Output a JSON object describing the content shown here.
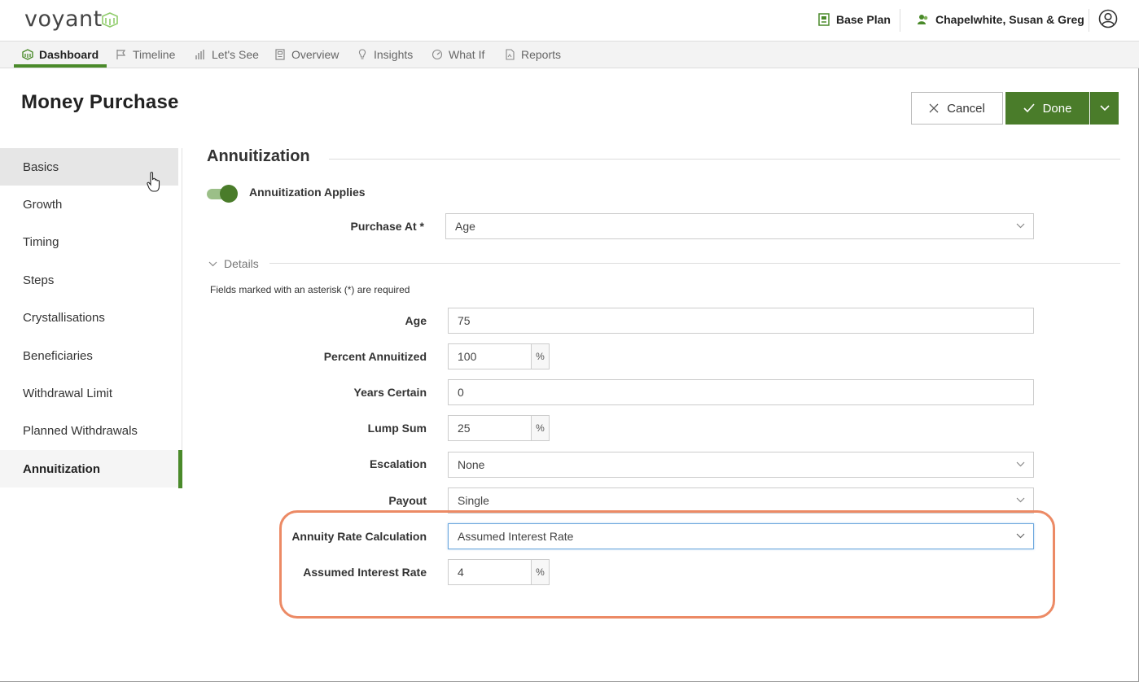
{
  "header": {
    "logo": "voyant",
    "plan": "Base Plan",
    "client": "Chapelwhite, Susan & Greg"
  },
  "nav": {
    "tabs": [
      {
        "label": "Dashboard",
        "icon": "dashboard-icon",
        "active": true
      },
      {
        "label": "Timeline",
        "icon": "flag-icon"
      },
      {
        "label": "Let's See",
        "icon": "bar-chart-icon"
      },
      {
        "label": "Overview",
        "icon": "overview-icon"
      },
      {
        "label": "Insights",
        "icon": "lightbulb-icon"
      },
      {
        "label": "What If",
        "icon": "gauge-icon"
      },
      {
        "label": "Reports",
        "icon": "report-icon"
      }
    ]
  },
  "page": {
    "title": "Money Purchase",
    "cancel_label": "Cancel",
    "done_label": "Done"
  },
  "sidebar": {
    "items": [
      {
        "label": "Basics"
      },
      {
        "label": "Growth"
      },
      {
        "label": "Timing"
      },
      {
        "label": "Steps"
      },
      {
        "label": "Crystallisations"
      },
      {
        "label": "Beneficiaries"
      },
      {
        "label": "Withdrawal Limit"
      },
      {
        "label": "Planned Withdrawals"
      },
      {
        "label": "Annuitization",
        "active": true
      }
    ]
  },
  "main": {
    "section_title": "Annuitization",
    "toggle_label": "Annuitization Applies",
    "toggle_on": true,
    "purchase_at_label": "Purchase At *",
    "purchase_at_value": "Age",
    "details_label": "Details",
    "required_note": "Fields marked with an asterisk (*) are required",
    "fields": {
      "age": {
        "label": "Age",
        "value": "75"
      },
      "percent_annuitized": {
        "label": "Percent Annuitized",
        "value": "100",
        "unit": "%"
      },
      "years_certain": {
        "label": "Years Certain",
        "value": "0"
      },
      "lump_sum": {
        "label": "Lump Sum",
        "value": "25",
        "unit": "%"
      },
      "escalation": {
        "label": "Escalation",
        "value": "None"
      },
      "payout": {
        "label": "Payout",
        "value": "Single"
      },
      "annuity_rate_calc": {
        "label": "Annuity Rate Calculation",
        "value": "Assumed Interest Rate"
      },
      "assumed_interest_rate": {
        "label": "Assumed Interest Rate",
        "value": "4",
        "unit": "%"
      }
    }
  },
  "colors": {
    "brand_green": "#4a7c2a",
    "highlight": "#ec8a65"
  }
}
